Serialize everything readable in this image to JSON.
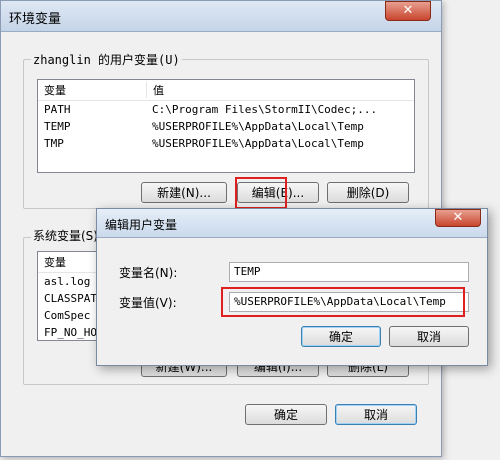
{
  "outer_dialog": {
    "title": "环境变量",
    "close_glyph": "✕",
    "user_vars": {
      "group_label": "zhanglin 的用户变量(U)",
      "columns": [
        "变量",
        "值"
      ],
      "rows": [
        {
          "name": "PATH",
          "value": "C:\\Program Files\\StormII\\Codec;..."
        },
        {
          "name": "TEMP",
          "value": "%USERPROFILE%\\AppData\\Local\\Temp"
        },
        {
          "name": "TMP",
          "value": "%USERPROFILE%\\AppData\\Local\\Temp"
        }
      ],
      "buttons": {
        "new": "新建(N)...",
        "edit": "编辑(E)...",
        "delete": "删除(D)"
      }
    },
    "system_vars": {
      "group_label": "系统变量(S)",
      "columns": [
        "变量"
      ],
      "rows": [
        {
          "name": "asl.log"
        },
        {
          "name": "CLASSPATH"
        },
        {
          "name": "ComSpec"
        },
        {
          "name": "FP_NO_HOST"
        }
      ],
      "buttons": {
        "new": "新建(W)...",
        "edit": "编辑(I)...",
        "delete": "删除(L)"
      }
    },
    "ok": "确定",
    "cancel": "取消"
  },
  "edit_dialog": {
    "title": "编辑用户变量",
    "close_glyph": "✕",
    "name_label": "变量名(N):",
    "name_value": "TEMP",
    "value_label": "变量值(V):",
    "value_value": "%USERPROFILE%\\AppData\\Local\\Temp",
    "ok": "确定",
    "cancel": "取消"
  },
  "colors": {
    "highlight": "#e02020",
    "title_bar": "#cad9ec"
  }
}
